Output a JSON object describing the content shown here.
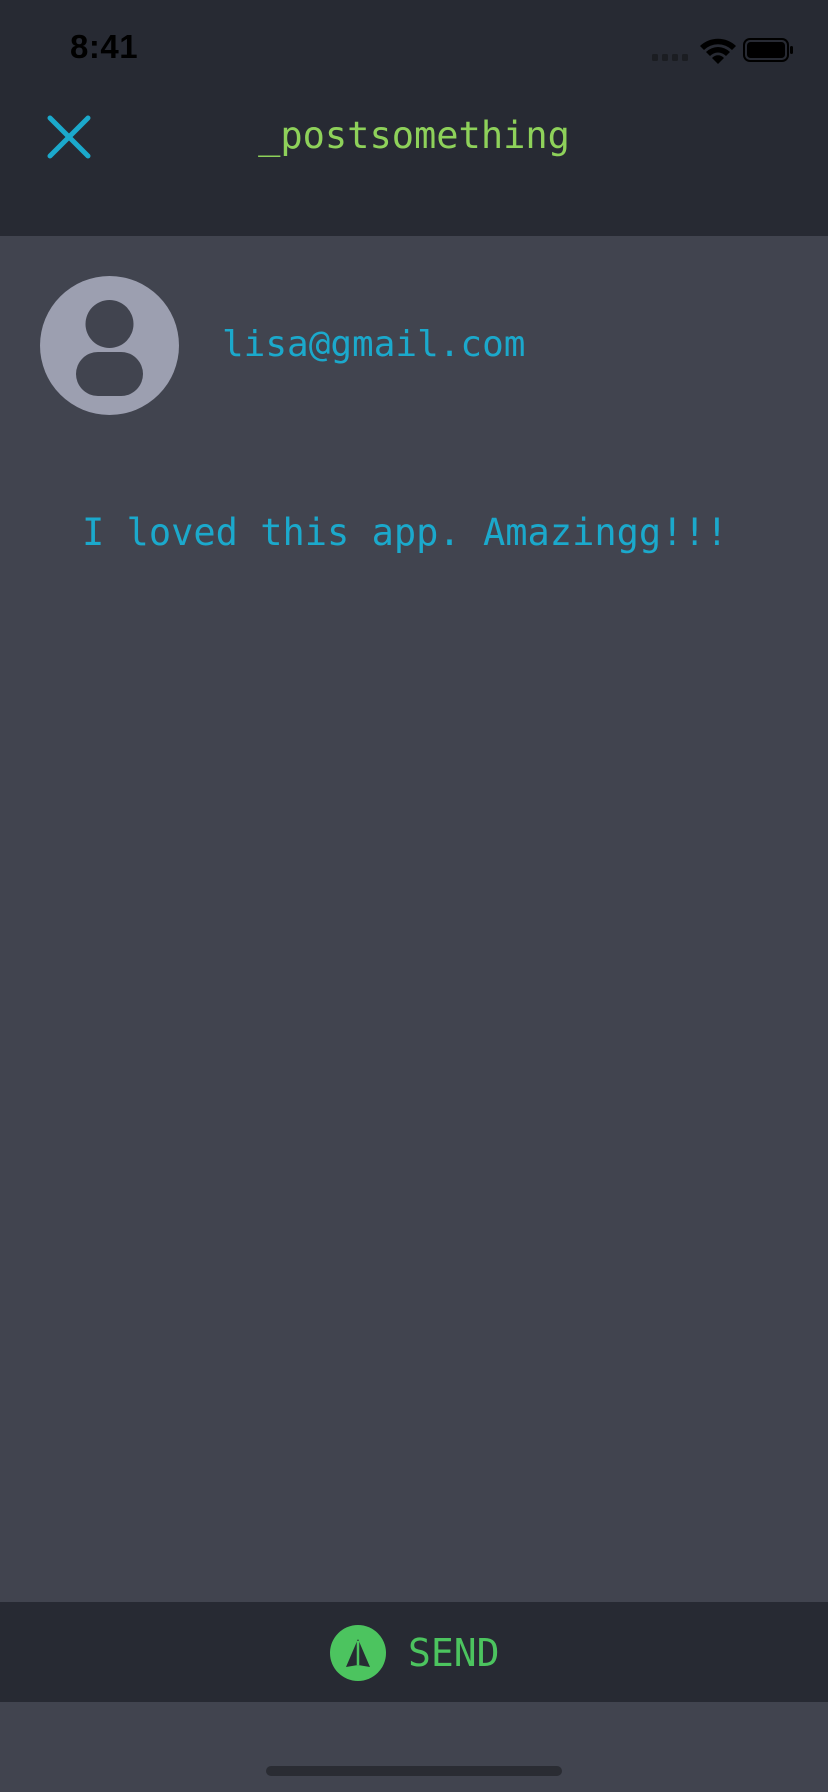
{
  "status_bar": {
    "time": "8:41",
    "icons": [
      "signal-icon",
      "wifi-icon",
      "battery-icon"
    ]
  },
  "header": {
    "title": "_postsomething",
    "close_icon": "close-icon"
  },
  "profile": {
    "avatar_icon": "user-avatar-icon",
    "email": "lisa@gmail.com"
  },
  "post": {
    "text": "I loved this app. Amazingg!!!"
  },
  "footer": {
    "send_icon": "send-icon",
    "send_label": "SEND"
  },
  "colors": {
    "background": "#41444f",
    "bar_background": "#272a33",
    "title": "#8ed15a",
    "accent_blue": "#1ba9cc",
    "send_green": "#4cc45f",
    "avatar_bg": "#9c9fb0"
  }
}
